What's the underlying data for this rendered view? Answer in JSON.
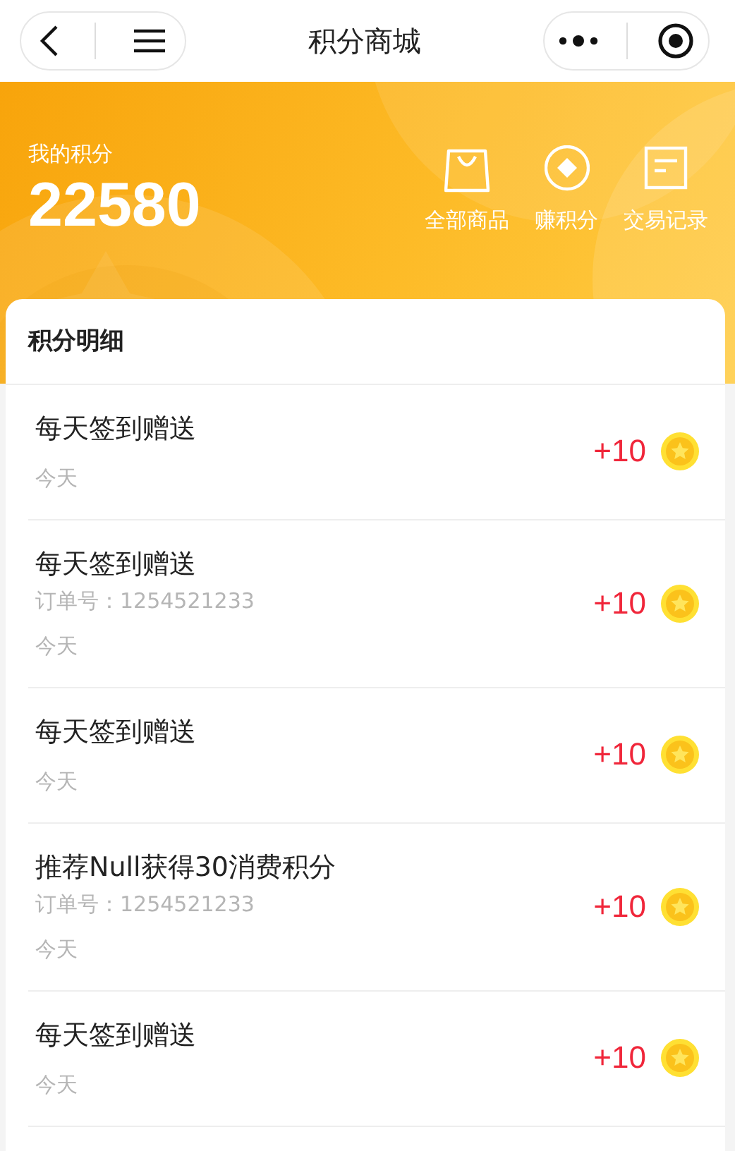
{
  "nav": {
    "title": "积分商城"
  },
  "summary": {
    "label": "我的积分",
    "points": "22580"
  },
  "shortcuts": [
    {
      "label": "全部商品",
      "kind": "bag"
    },
    {
      "label": "赚积分",
      "kind": "diamond"
    },
    {
      "label": "交易记录",
      "kind": "record"
    }
  ],
  "details": {
    "title": "积分明细",
    "records": [
      {
        "title": "每天签到赠送",
        "date": "今天",
        "amount": "+10"
      },
      {
        "title": "每天签到赠送",
        "order": "订单号：1254521233",
        "date": "今天",
        "amount": "+10"
      },
      {
        "title": "每天签到赠送",
        "date": "今天",
        "amount": "+10"
      },
      {
        "title": "推荐Null获得30消费积分",
        "order": "订单号：1254521233",
        "date": "今天",
        "amount": "+10"
      },
      {
        "title": "每天签到赠送",
        "date": "今天",
        "amount": "+10"
      }
    ]
  }
}
